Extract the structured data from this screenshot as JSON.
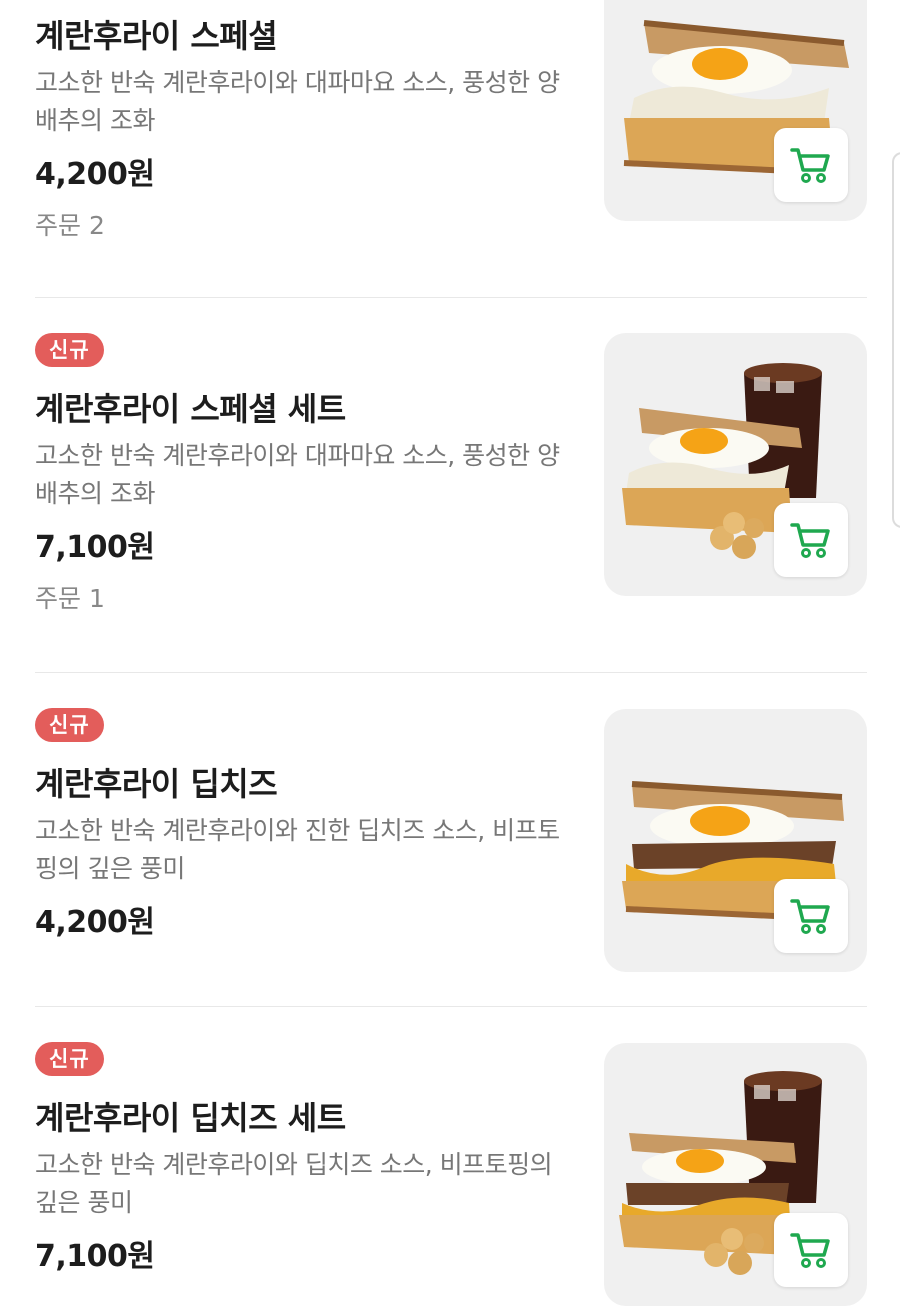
{
  "items": [
    {
      "name": "계란후라이 스페셜",
      "desc": "고소한 반숙 계란후라이와 대파마요 소스, 풍성한 양배추의 조화",
      "price": "4,200원",
      "orders": "주문 2",
      "badge": "",
      "image_icon": "egg-sandwich-icon"
    },
    {
      "name": "계란후라이 스페셜 세트",
      "desc": "고소한 반숙 계란후라이와 대파마요 소스, 풍성한 양배추의 조화",
      "price": "7,100원",
      "orders": "주문 1",
      "badge": "신규",
      "image_icon": "sandwich-set-icon"
    },
    {
      "name": "계란후라이 딥치즈",
      "desc": "고소한 반숙 계란후라이와 진한 딥치즈 소스, 비프토핑의 깊은 풍미",
      "price": "4,200원",
      "orders": "",
      "badge": "신규",
      "image_icon": "egg-sandwich-icon"
    },
    {
      "name": "계란후라이 딥치즈 세트",
      "desc": "고소한 반숙 계란후라이와 딥치즈 소스, 비프토핑의 깊은 풍미",
      "price": "7,100원",
      "orders": "",
      "badge": "신규",
      "image_icon": "sandwich-set-icon"
    }
  ],
  "colors": {
    "badge": "#e35d5b",
    "cart_icon": "#1fa84f",
    "card_bg": "#f0f0f0"
  },
  "icons": {
    "cart": "shopping-cart-icon"
  }
}
